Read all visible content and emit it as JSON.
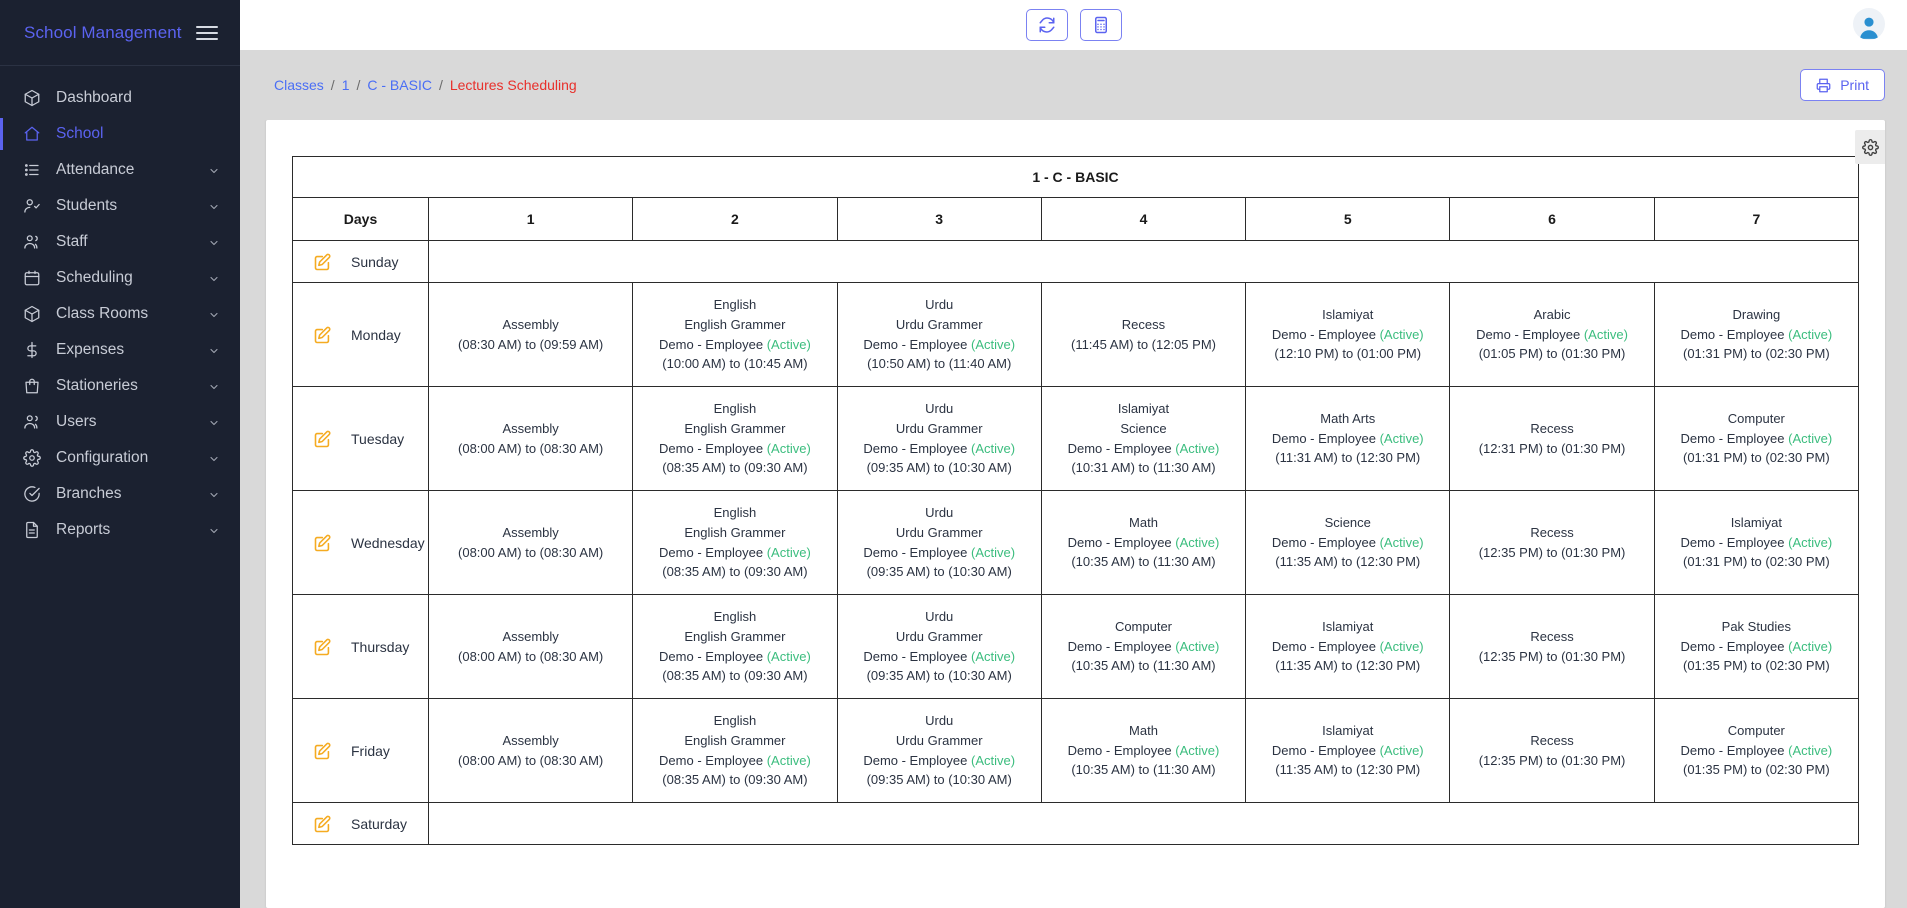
{
  "sidebar": {
    "brand": "School Management",
    "menu_icon": "hamburger-icon",
    "items": [
      {
        "label": "Dashboard",
        "icon": "cube-icon",
        "chevron": false,
        "active": false
      },
      {
        "label": "School",
        "icon": "home-icon",
        "chevron": false,
        "active": true
      },
      {
        "label": "Attendance",
        "icon": "list-icon",
        "chevron": true,
        "active": false
      },
      {
        "label": "Students",
        "icon": "user-check-icon",
        "chevron": true,
        "active": false
      },
      {
        "label": "Staff",
        "icon": "users-icon",
        "chevron": true,
        "active": false
      },
      {
        "label": "Scheduling",
        "icon": "calendar-icon",
        "chevron": true,
        "active": false
      },
      {
        "label": "Class Rooms",
        "icon": "cube-icon",
        "chevron": true,
        "active": false
      },
      {
        "label": "Expenses",
        "icon": "dollar-icon",
        "chevron": true,
        "active": false
      },
      {
        "label": "Stationeries",
        "icon": "bag-icon",
        "chevron": true,
        "active": false
      },
      {
        "label": "Users",
        "icon": "users-icon",
        "chevron": true,
        "active": false
      },
      {
        "label": "Configuration",
        "icon": "gear-icon",
        "chevron": true,
        "active": false
      },
      {
        "label": "Branches",
        "icon": "check-circle-icon",
        "chevron": true,
        "active": false
      },
      {
        "label": "Reports",
        "icon": "document-icon",
        "chevron": true,
        "active": false
      }
    ]
  },
  "topbar": {
    "refresh_icon": "refresh-icon",
    "calculator_icon": "calculator-icon",
    "avatar_icon": "user-avatar-icon"
  },
  "breadcrumb": {
    "items": [
      {
        "label": "Classes",
        "type": "link"
      },
      {
        "label": "1",
        "type": "link"
      },
      {
        "label": "C - BASIC",
        "type": "link"
      },
      {
        "label": "Lectures Scheduling",
        "type": "current"
      }
    ],
    "separator": "/"
  },
  "actions": {
    "print_label": "Print",
    "print_icon": "printer-icon",
    "settings_icon": "gear-icon"
  },
  "colors": {
    "accent": "#5b63f0",
    "sidebar_bg": "#1b2130",
    "active_green": "#3bbd7e",
    "current_crumb": "#e8302b",
    "edit_icon": "#f5ab21"
  },
  "schedule": {
    "title": "1 - C - BASIC",
    "days_header": "Days",
    "period_headers": [
      "1",
      "2",
      "3",
      "4",
      "5",
      "6",
      "7"
    ],
    "edit_icon": "edit-pencil-icon",
    "rows": [
      {
        "day": "Sunday",
        "slots": [
          null,
          null,
          null,
          null,
          null,
          null,
          null
        ]
      },
      {
        "day": "Monday",
        "slots": [
          {
            "subject": "Assembly",
            "topic": "",
            "teacher": "",
            "status": "",
            "time": "(08:30 AM) to (09:59 AM)"
          },
          {
            "subject": "English",
            "topic": "English Grammer",
            "teacher": "Demo - Employee",
            "status": "(Active)",
            "time": "(10:00 AM) to (10:45 AM)"
          },
          {
            "subject": "Urdu",
            "topic": "Urdu Grammer",
            "teacher": "Demo - Employee",
            "status": "(Active)",
            "time": "(10:50 AM) to (11:40 AM)"
          },
          {
            "subject": "Recess",
            "topic": "",
            "teacher": "",
            "status": "",
            "time": "(11:45 AM) to (12:05 PM)"
          },
          {
            "subject": "Islamiyat",
            "topic": "",
            "teacher": "Demo - Employee",
            "status": "(Active)",
            "time": "(12:10 PM) to (01:00 PM)"
          },
          {
            "subject": "Arabic",
            "topic": "",
            "teacher": "Demo - Employee",
            "status": "(Active)",
            "time": "(01:05 PM) to (01:30 PM)"
          },
          {
            "subject": "Drawing",
            "topic": "",
            "teacher": "Demo - Employee",
            "status": "(Active)",
            "time": "(01:31 PM) to (02:30 PM)"
          }
        ]
      },
      {
        "day": "Tuesday",
        "slots": [
          {
            "subject": "Assembly",
            "topic": "",
            "teacher": "",
            "status": "",
            "time": "(08:00 AM) to (08:30 AM)"
          },
          {
            "subject": "English",
            "topic": "English Grammer",
            "teacher": "Demo - Employee",
            "status": "(Active)",
            "time": "(08:35 AM) to (09:30 AM)"
          },
          {
            "subject": "Urdu",
            "topic": "Urdu Grammer",
            "teacher": "Demo - Employee",
            "status": "(Active)",
            "time": "(09:35 AM) to (10:30 AM)"
          },
          {
            "subject": "Islamiyat",
            "topic": "Science",
            "teacher": "Demo - Employee",
            "status": "(Active)",
            "time": "(10:31 AM) to (11:30 AM)"
          },
          {
            "subject": "Math Arts",
            "topic": "",
            "teacher": "Demo - Employee",
            "status": "(Active)",
            "time": "(11:31 AM) to (12:30 PM)"
          },
          {
            "subject": "Recess",
            "topic": "",
            "teacher": "",
            "status": "",
            "time": "(12:31 PM) to (01:30 PM)"
          },
          {
            "subject": "Computer",
            "topic": "",
            "teacher": "Demo - Employee",
            "status": "(Active)",
            "time": "(01:31 PM) to (02:30 PM)"
          }
        ]
      },
      {
        "day": "Wednesday",
        "slots": [
          {
            "subject": "Assembly",
            "topic": "",
            "teacher": "",
            "status": "",
            "time": "(08:00 AM) to (08:30 AM)"
          },
          {
            "subject": "English",
            "topic": "English Grammer",
            "teacher": "Demo - Employee",
            "status": "(Active)",
            "time": "(08:35 AM) to (09:30 AM)"
          },
          {
            "subject": "Urdu",
            "topic": "Urdu Grammer",
            "teacher": "Demo - Employee",
            "status": "(Active)",
            "time": "(09:35 AM) to (10:30 AM)"
          },
          {
            "subject": "Math",
            "topic": "",
            "teacher": "Demo - Employee",
            "status": "(Active)",
            "time": "(10:35 AM) to (11:30 AM)"
          },
          {
            "subject": "Science",
            "topic": "",
            "teacher": "Demo - Employee",
            "status": "(Active)",
            "time": "(11:35 AM) to (12:30 PM)"
          },
          {
            "subject": "Recess",
            "topic": "",
            "teacher": "",
            "status": "",
            "time": "(12:35 PM) to (01:30 PM)"
          },
          {
            "subject": "Islamiyat",
            "topic": "",
            "teacher": "Demo - Employee",
            "status": "(Active)",
            "time": "(01:31 PM) to (02:30 PM)"
          }
        ]
      },
      {
        "day": "Thursday",
        "slots": [
          {
            "subject": "Assembly",
            "topic": "",
            "teacher": "",
            "status": "",
            "time": "(08:00 AM) to (08:30 AM)"
          },
          {
            "subject": "English",
            "topic": "English Grammer",
            "teacher": "Demo - Employee",
            "status": "(Active)",
            "time": "(08:35 AM) to (09:30 AM)"
          },
          {
            "subject": "Urdu",
            "topic": "Urdu Grammer",
            "teacher": "Demo - Employee",
            "status": "(Active)",
            "time": "(09:35 AM) to (10:30 AM)"
          },
          {
            "subject": "Computer",
            "topic": "",
            "teacher": "Demo - Employee",
            "status": "(Active)",
            "time": "(10:35 AM) to (11:30 AM)"
          },
          {
            "subject": "Islamiyat",
            "topic": "",
            "teacher": "Demo - Employee",
            "status": "(Active)",
            "time": "(11:35 AM) to (12:30 PM)"
          },
          {
            "subject": "Recess",
            "topic": "",
            "teacher": "",
            "status": "",
            "time": "(12:35 PM) to (01:30 PM)"
          },
          {
            "subject": "Pak Studies",
            "topic": "",
            "teacher": "Demo - Employee",
            "status": "(Active)",
            "time": "(01:35 PM) to (02:30 PM)"
          }
        ]
      },
      {
        "day": "Friday",
        "slots": [
          {
            "subject": "Assembly",
            "topic": "",
            "teacher": "",
            "status": "",
            "time": "(08:00 AM) to (08:30 AM)"
          },
          {
            "subject": "English",
            "topic": "English Grammer",
            "teacher": "Demo - Employee",
            "status": "(Active)",
            "time": "(08:35 AM) to (09:30 AM)"
          },
          {
            "subject": "Urdu",
            "topic": "Urdu Grammer",
            "teacher": "Demo - Employee",
            "status": "(Active)",
            "time": "(09:35 AM) to (10:30 AM)"
          },
          {
            "subject": "Math",
            "topic": "",
            "teacher": "Demo - Employee",
            "status": "(Active)",
            "time": "(10:35 AM) to (11:30 AM)"
          },
          {
            "subject": "Islamiyat",
            "topic": "",
            "teacher": "Demo - Employee",
            "status": "(Active)",
            "time": "(11:35 AM) to (12:30 PM)"
          },
          {
            "subject": "Recess",
            "topic": "",
            "teacher": "",
            "status": "",
            "time": "(12:35 PM) to (01:30 PM)"
          },
          {
            "subject": "Computer",
            "topic": "",
            "teacher": "Demo - Employee",
            "status": "(Active)",
            "time": "(01:35 PM) to (02:30 PM)"
          }
        ]
      },
      {
        "day": "Saturday",
        "slots": [
          null,
          null,
          null,
          null,
          null,
          null,
          null
        ]
      }
    ]
  }
}
